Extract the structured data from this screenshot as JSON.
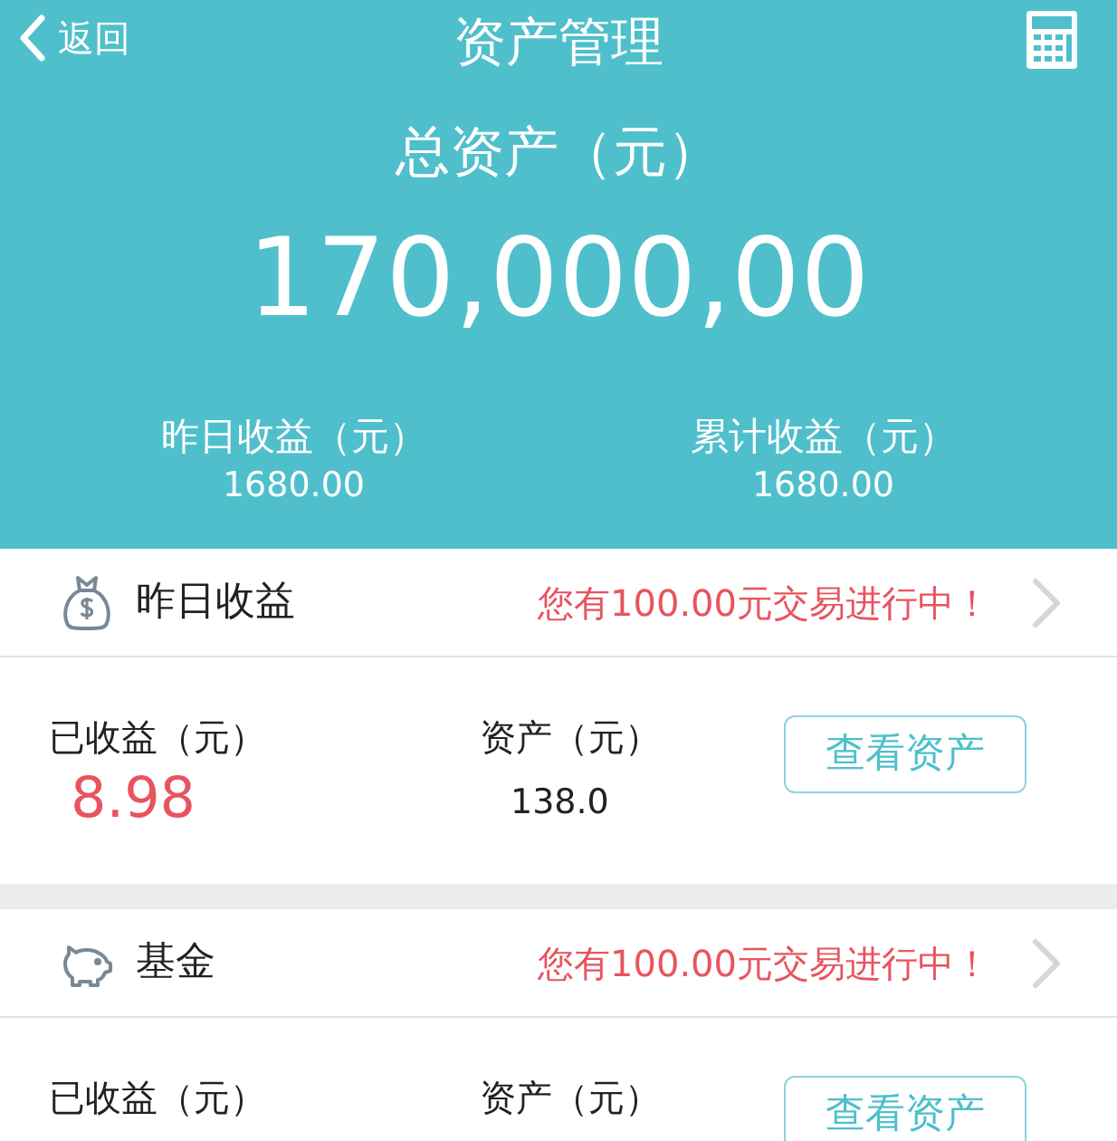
{
  "nav": {
    "back": "返回",
    "title": "资产管理"
  },
  "summary": {
    "total_label": "总资产（元）",
    "total": "170,000,00",
    "stats": [
      {
        "label": "昨日收益（元）",
        "value": "1680.00"
      },
      {
        "label": "累计收益（元）",
        "value": "1680.00"
      }
    ]
  },
  "products": [
    {
      "kind": "money",
      "title": "昨日收益",
      "notice": "您有100.00元交易进行中！",
      "earned_label": "已收益（元）",
      "earned": "8.98",
      "asset_label": "资产（元）",
      "asset": "138.0",
      "button": "查看资产"
    },
    {
      "kind": "fund",
      "title": "基金",
      "notice": "您有100.00元交易进行中！",
      "earned_label": "已收益（元）",
      "asset_label": "资产（元）",
      "button": "查看资产"
    }
  ]
}
